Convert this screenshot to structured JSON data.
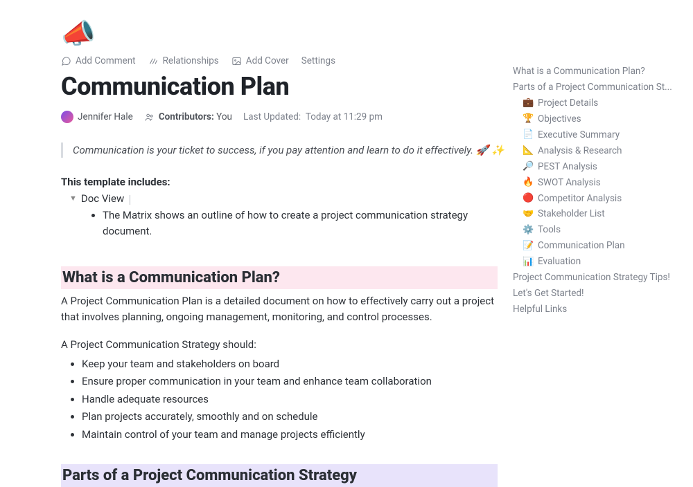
{
  "pageIcon": "📣",
  "toolbar": {
    "addComment": "Add Comment",
    "relationships": "Relationships",
    "addCover": "Add Cover",
    "settings": "Settings"
  },
  "title": "Communication Plan",
  "meta": {
    "author": "Jennifer Hale",
    "contributorsLabel": "Contributors:",
    "contributorsValue": "You",
    "lastUpdatedLabel": "Last Updated:",
    "lastUpdatedValue": "Today at 11:29 pm"
  },
  "quote": "Communication is your ticket to success, if you pay attention and learn to do it effectively. 🚀 ✨",
  "templateIncludesLabel": "This template includes:",
  "toggleItem": "Doc View",
  "toggleDetail": "The Matrix shows an outline of how to create a project communication strategy document.",
  "section1": {
    "heading": "What is a Communication Plan?",
    "para1": "A Project Communication Plan is a detailed document on how to effectively carry out a project that involves planning, ongoing management, monitoring, and control processes.",
    "lead": "A Project Communication Strategy should:",
    "bullets": [
      "Keep your team and stakeholders on board",
      "Ensure proper communication in your team and enhance team collaboration",
      "Handle adequate resources",
      "Plan projects accurately, smoothly and on schedule",
      "Maintain control of your team and manage projects efficiently"
    ]
  },
  "section2": {
    "heading": "Parts of a Project Communication Strategy"
  },
  "toc": {
    "top": [
      "What is a Communication Plan?",
      "Parts of a Project Communication St..."
    ],
    "sub": [
      {
        "icon": "💼",
        "label": "Project Details"
      },
      {
        "icon": "🏆",
        "label": "Objectives"
      },
      {
        "icon": "📄",
        "label": "Executive Summary"
      },
      {
        "icon": "📐",
        "label": "Analysis & Research"
      },
      {
        "icon": "🔎",
        "label": "PEST Analysis"
      },
      {
        "icon": "🔥",
        "label": "SWOT Analysis"
      },
      {
        "icon": "🔴",
        "label": "Competitor Analysis"
      },
      {
        "icon": "🤝",
        "label": "Stakeholder List"
      },
      {
        "icon": "⚙️",
        "label": "Tools"
      },
      {
        "icon": "📝",
        "label": "Communication Plan"
      },
      {
        "icon": "📊",
        "label": "Evaluation"
      }
    ],
    "bottom": [
      "Project Communication Strategy Tips!",
      "Let's Get Started!",
      "Helpful Links"
    ]
  }
}
